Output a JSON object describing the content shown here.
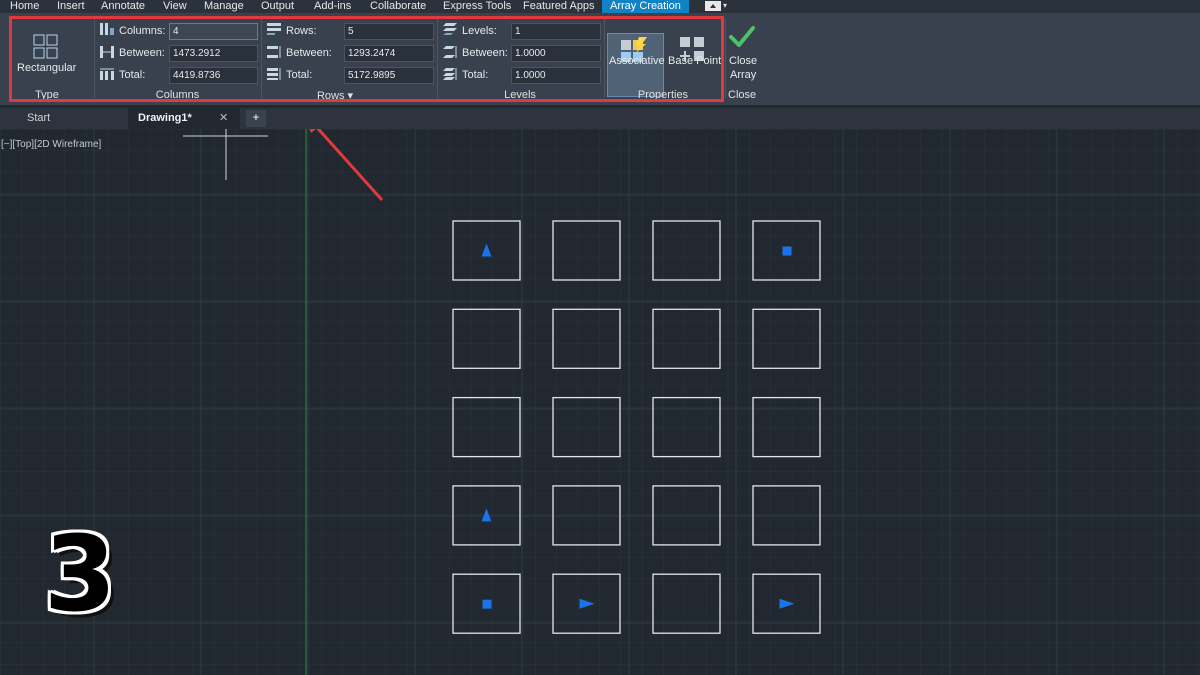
{
  "menu": {
    "items": [
      "Home",
      "Insert",
      "Annotate",
      "View",
      "Manage",
      "Output",
      "Add-ins",
      "Collaborate",
      "Express Tools",
      "Featured Apps"
    ],
    "active": "Array Creation"
  },
  "ribbon": {
    "type_panel": {
      "button_label": "Rectangular",
      "title": "Type"
    },
    "columns_panel": {
      "title": "Columns",
      "columns_label": "Columns:",
      "columns_value": "4",
      "between_label": "Between:",
      "between_value": "1473.2912",
      "total_label": "Total:",
      "total_value": "4419.8736"
    },
    "rows_panel": {
      "title": "Rows",
      "rows_label": "Rows:",
      "rows_value": "5",
      "between_label": "Between:",
      "between_value": "1293.2474",
      "total_label": "Total:",
      "total_value": "5172.9895"
    },
    "levels_panel": {
      "title": "Levels",
      "levels_label": "Levels:",
      "levels_value": "1",
      "between_label": "Between:",
      "between_value": "1.0000",
      "total_label": "Total:",
      "total_value": "1.0000"
    },
    "properties_panel": {
      "title": "Properties",
      "associative_label": "Associative",
      "basepoint_label": "Base Point"
    },
    "close_panel": {
      "title": "Close",
      "close_line1": "Close",
      "close_line2": "Array"
    }
  },
  "tabs": {
    "start": "Start",
    "drawing": "Drawing1*",
    "close_glyph": "✕",
    "add_glyph": "+"
  },
  "viewport": {
    "label": "[−][Top][2D Wireframe]"
  },
  "badge": {
    "number": "3"
  },
  "array": {
    "columns": 4,
    "rows": 5,
    "marker_color": "#1a73e8",
    "markers": [
      {
        "row": 0,
        "col": 0,
        "shape": "triangle-up"
      },
      {
        "row": 0,
        "col": 3,
        "shape": "square"
      },
      {
        "row": 3,
        "col": 0,
        "shape": "triangle-up"
      },
      {
        "row": 4,
        "col": 0,
        "shape": "square"
      },
      {
        "row": 4,
        "col": 1,
        "shape": "triangle-right"
      },
      {
        "row": 4,
        "col": 3,
        "shape": "triangle-right"
      }
    ]
  },
  "colors": {
    "highlight": "#e03a3f",
    "accent": "#1083c6",
    "check": "#4cc36a"
  }
}
